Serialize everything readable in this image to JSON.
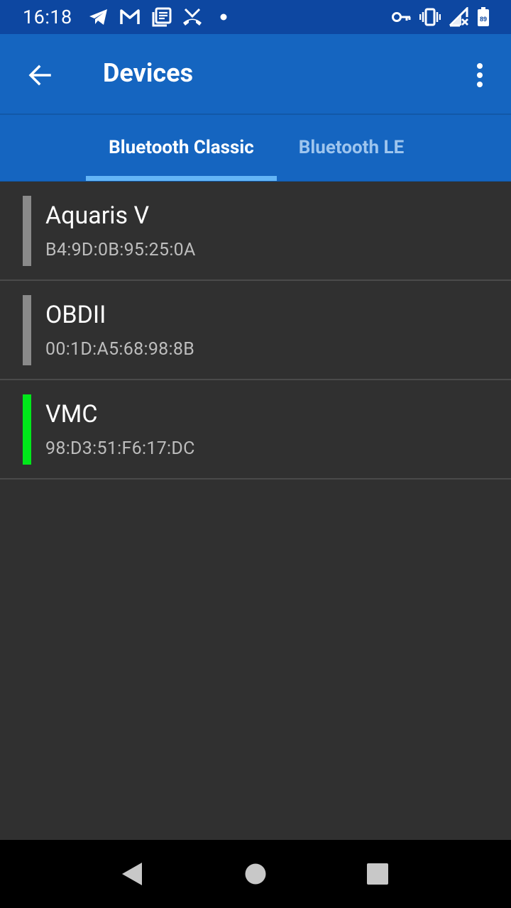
{
  "status_bar": {
    "time": "16:18",
    "battery_level": "89",
    "icons": [
      "telegram-icon",
      "gmail-icon",
      "news-icon",
      "missed-call-icon",
      "dot-icon",
      "vpn-key-icon",
      "vibrate-icon",
      "signal-icon",
      "battery-icon"
    ]
  },
  "app_bar": {
    "title": "Devices",
    "back_icon": "arrow-back-icon",
    "menu_icon": "more-vert-icon"
  },
  "tabs": [
    {
      "label": "Bluetooth Classic",
      "selected": true
    },
    {
      "label": "Bluetooth LE",
      "selected": false
    }
  ],
  "devices": [
    {
      "name": "Aquaris V",
      "address": "B4:9D:0B:95:25:0A",
      "connected": false
    },
    {
      "name": "OBDII",
      "address": "00:1D:A5:68:98:8B",
      "connected": false
    },
    {
      "name": "VMC",
      "address": "98:D3:51:F6:17:DC",
      "connected": true
    }
  ],
  "colors": {
    "status_bar": "#0d47a1",
    "primary": "#1565c0",
    "tab_indicator": "#64b5f6",
    "background": "#303030",
    "connected": "#00e81a",
    "disconnected": "#8a8a8a"
  },
  "nav_bar": {
    "buttons": [
      "back-triangle-icon",
      "home-circle-icon",
      "recents-square-icon"
    ]
  }
}
